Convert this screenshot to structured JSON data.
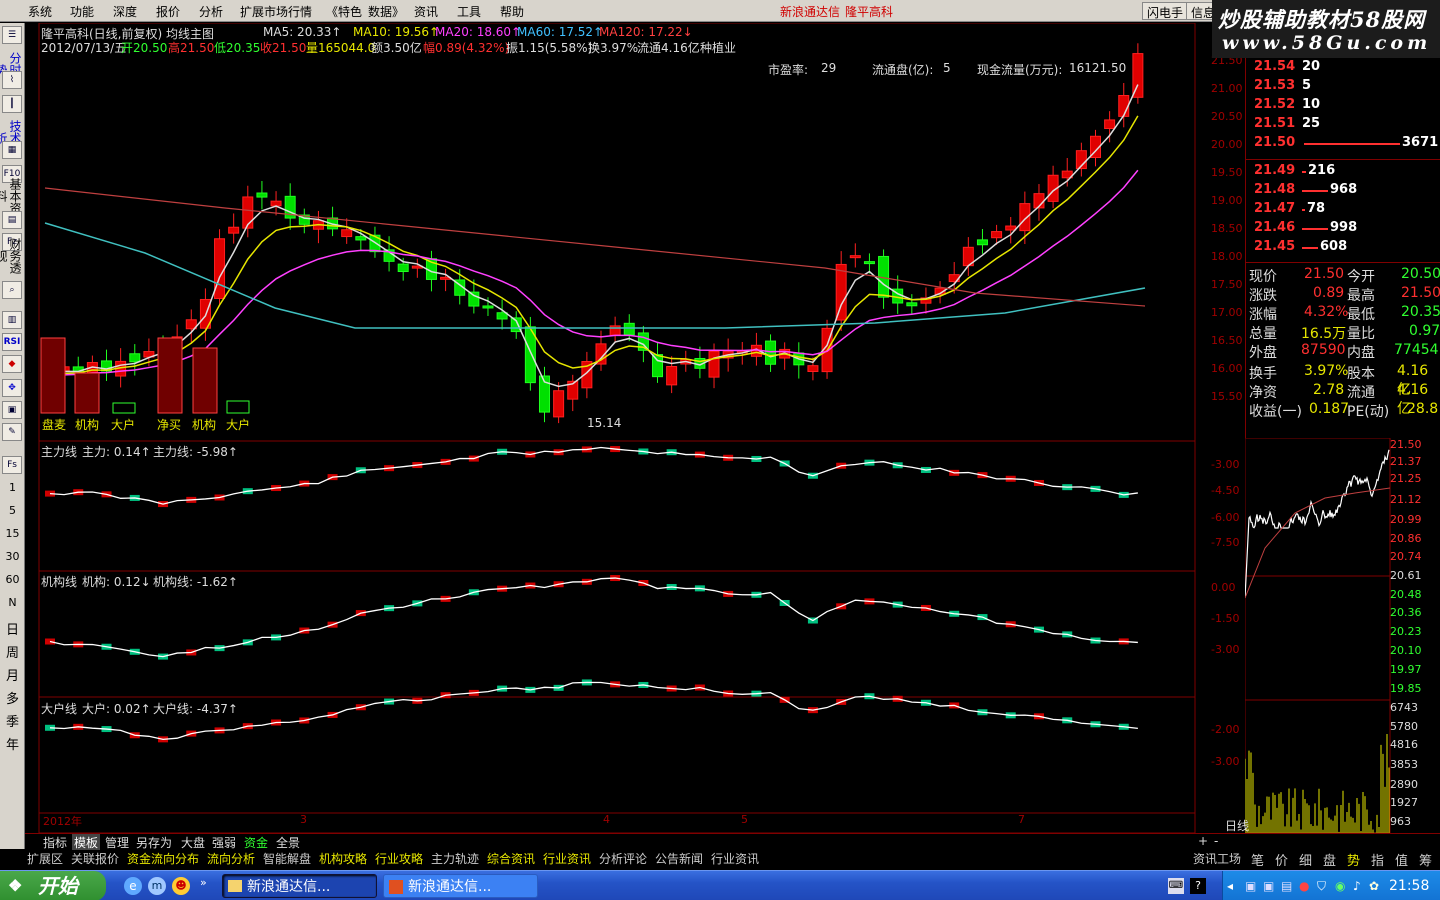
{
  "menubar": {
    "items": [
      "系统",
      "功能",
      "深度",
      "报价",
      "分析",
      "扩展市场行情",
      "《特色",
      "数据》",
      "资讯",
      "工具",
      "帮助"
    ],
    "notice_app": "新浪通达信",
    "notice_stock": "隆平高科",
    "btn_flash": "闪电手",
    "btn_info": "信息"
  },
  "watermark": {
    "line1": "炒股辅助教材58股网",
    "line2": "www.58Gu.com"
  },
  "toolbar": {
    "tab_fenshi": "分时走势",
    "tab_jishu": "技术分析",
    "tab_jiben": "基本资料",
    "tab_caiwu": "财务透视",
    "icons": [
      "F10",
      "Fz",
      "RSI",
      "Fs"
    ],
    "periods": [
      "1",
      "5",
      "15",
      "30",
      "60",
      "N",
      "日",
      "周",
      "月",
      "多",
      "季",
      "年"
    ]
  },
  "chart_header": {
    "title": "隆平高科(日线,前复权) 均线主图",
    "ma5": "MA5: 20.33↑",
    "ma10": "MA10: 19.56↑",
    "ma20": "MA20: 18.60↑",
    "ma60": "MA60: 17.52↑",
    "ma120": "MA120: 17.22↓",
    "date": "2012/07/13/五",
    "open": "开20.50",
    "high": "高21.50",
    "low": "低20.35",
    "close": "收21.50",
    "vol": "量165044.0",
    "amount": "额3.50亿",
    "change": "幅0.89(4.32%)",
    "amplitude": "振1.15(5.58%)",
    "turnover": "换3.97%",
    "float": "流通4.16亿",
    "industry": "种植业",
    "pe_label": "市盈率:",
    "pe_value": "29",
    "floatcap_label": "流通盘(亿):",
    "floatcap_value": "5",
    "cashflow_label": "现金流量(万元):",
    "cashflow_value": "16121.50",
    "min_price_label": "15.14",
    "bar_labels": [
      "盘麦",
      "机构",
      "大户",
      "净买",
      "机构",
      "大户"
    ],
    "price_ticks": [
      "21.50",
      "21.00",
      "20.50",
      "20.00",
      "19.50",
      "19.00",
      "18.50",
      "18.00",
      "17.50",
      "17.00",
      "16.50",
      "16.00",
      "15.50"
    ]
  },
  "subcharts": {
    "main": {
      "name": "主力线",
      "v1": "主力: 0.14↑",
      "v2": "主力线: -5.98↑",
      "ticks": [
        "-3.00",
        "-4.50",
        "-6.00",
        "-7.50"
      ]
    },
    "inst": {
      "name": "机构线",
      "v1": "机构: 0.12↓",
      "v2": "机构线: -1.62↑",
      "ticks": [
        "0.00",
        "-1.50",
        "-3.00"
      ]
    },
    "large": {
      "name": "大户线",
      "v1": "大户: 0.02↑",
      "v2": "大户线: -4.37↑",
      "ticks": [
        "-2.00",
        "-3.00"
      ]
    },
    "x_labels": [
      "2012年",
      "3",
      "4",
      "5",
      "7"
    ]
  },
  "orderbook": {
    "asks": [
      {
        "price": "21.54",
        "vol": "20"
      },
      {
        "price": "21.53",
        "vol": "5"
      },
      {
        "price": "21.52",
        "vol": "10"
      },
      {
        "price": "21.51",
        "vol": "25"
      },
      {
        "price": "21.50",
        "vol": "3671"
      }
    ],
    "bids": [
      {
        "price": "21.49",
        "vol": "216"
      },
      {
        "price": "21.48",
        "vol": "968"
      },
      {
        "price": "21.47",
        "vol": "78"
      },
      {
        "price": "21.46",
        "vol": "998"
      },
      {
        "price": "21.45",
        "vol": "608"
      }
    ]
  },
  "quote": [
    {
      "l1": "现价",
      "v1": "21.50",
      "l2": "今开",
      "v2": "20.50"
    },
    {
      "l1": "涨跌",
      "v1": "0.89",
      "l2": "最高",
      "v2": "21.50"
    },
    {
      "l1": "涨幅",
      "v1": "4.32%",
      "l2": "最低",
      "v2": "20.35"
    },
    {
      "l1": "总量",
      "v1": "16.5万",
      "l2": "量比",
      "v2": "0.97"
    },
    {
      "l1": "外盘",
      "v1": "87590",
      "l2": "内盘",
      "v2": "77454"
    },
    {
      "l1": "换手",
      "v1": "3.97%",
      "l2": "股本",
      "v2": "4.16亿"
    },
    {
      "l1": "净资",
      "v1": "2.78",
      "l2": "流通",
      "v2": "4.16亿"
    },
    {
      "l1": "收益(一)",
      "v1": "0.187",
      "l2": "PE(动)",
      "v2": "28.8"
    }
  ],
  "intraday": {
    "price_ticks": [
      "21.50",
      "21.37",
      "21.25",
      "21.12",
      "20.99",
      "20.86",
      "20.74",
      "20.61",
      "20.48",
      "20.36",
      "20.23",
      "20.10",
      "19.97",
      "19.85"
    ],
    "vol_ticks": [
      "6743",
      "5780",
      "4816",
      "3853",
      "2890",
      "1927",
      "963"
    ]
  },
  "bottomtabs": {
    "tabs": [
      "指标",
      "模板",
      "管理",
      "另存为",
      "大盘",
      "强弱",
      "资金",
      "全景"
    ],
    "period": "日线"
  },
  "infobar": {
    "items": [
      "扩展区",
      "关联报价",
      "资金流向分布",
      "流向分析",
      "智能解盘",
      "机构攻略",
      "行业攻略",
      "主力轨迹",
      "综合资讯",
      "行业资讯",
      "分析评论",
      "公告新闻",
      "行业资讯"
    ],
    "right_items": [
      "资讯工场",
      "笔",
      "价",
      "细",
      "盘",
      "势",
      "指",
      "值",
      "筹"
    ]
  },
  "taskbar": {
    "start": "开始",
    "tasks": [
      "新浪通达信...",
      "新浪通达信..."
    ],
    "clock": "21:58"
  }
}
